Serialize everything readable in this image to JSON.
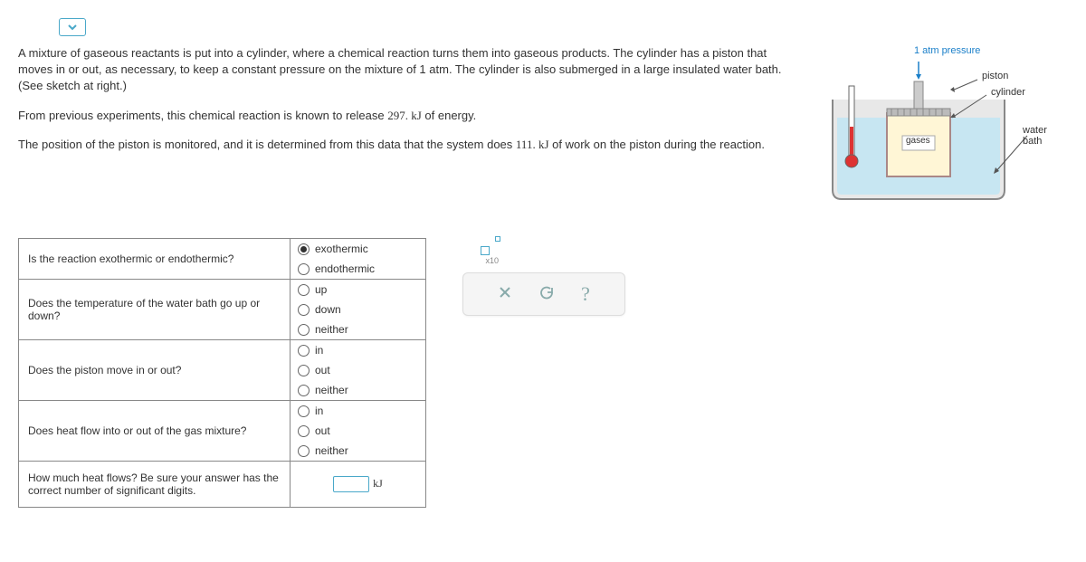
{
  "problem": {
    "p1": "A mixture of gaseous reactants is put into a cylinder, where a chemical reaction turns them into gaseous products. The cylinder has a piston that moves in or out, as necessary, to keep a constant pressure on the mixture of 1 atm. The cylinder is also submerged in a large insulated water bath. (See sketch at right.)",
    "p2_a": "From previous experiments, this chemical reaction is known to release ",
    "p2_val": "297. kJ",
    "p2_b": " of energy.",
    "p3_a": "The position of the piston is monitored, and it is determined from this data that the system does ",
    "p3_val": "111. kJ",
    "p3_b": " of work on the piston during the reaction."
  },
  "diagram": {
    "pressure": "1 atm pressure",
    "piston": "piston",
    "cylinder": "cylinder",
    "waterbath": "water bath",
    "gases": "gases"
  },
  "questions": {
    "q1": {
      "label": "Is the reaction exothermic or endothermic?",
      "opts": [
        "exothermic",
        "endothermic"
      ],
      "selected": 0
    },
    "q2": {
      "label": "Does the temperature of the water bath go up or down?",
      "opts": [
        "up",
        "down",
        "neither"
      ]
    },
    "q3": {
      "label": "Does the piston move in or out?",
      "opts": [
        "in",
        "out",
        "neither"
      ]
    },
    "q4": {
      "label": "Does heat flow into or out of the gas mixture?",
      "opts": [
        "in",
        "out",
        "neither"
      ]
    },
    "q5": {
      "label": "How much heat flows? Be sure your answer has the correct number of significant digits.",
      "unit": "kJ"
    }
  },
  "tools": {
    "x10": "x10",
    "close": "×",
    "reset": "↺",
    "help": "?"
  }
}
